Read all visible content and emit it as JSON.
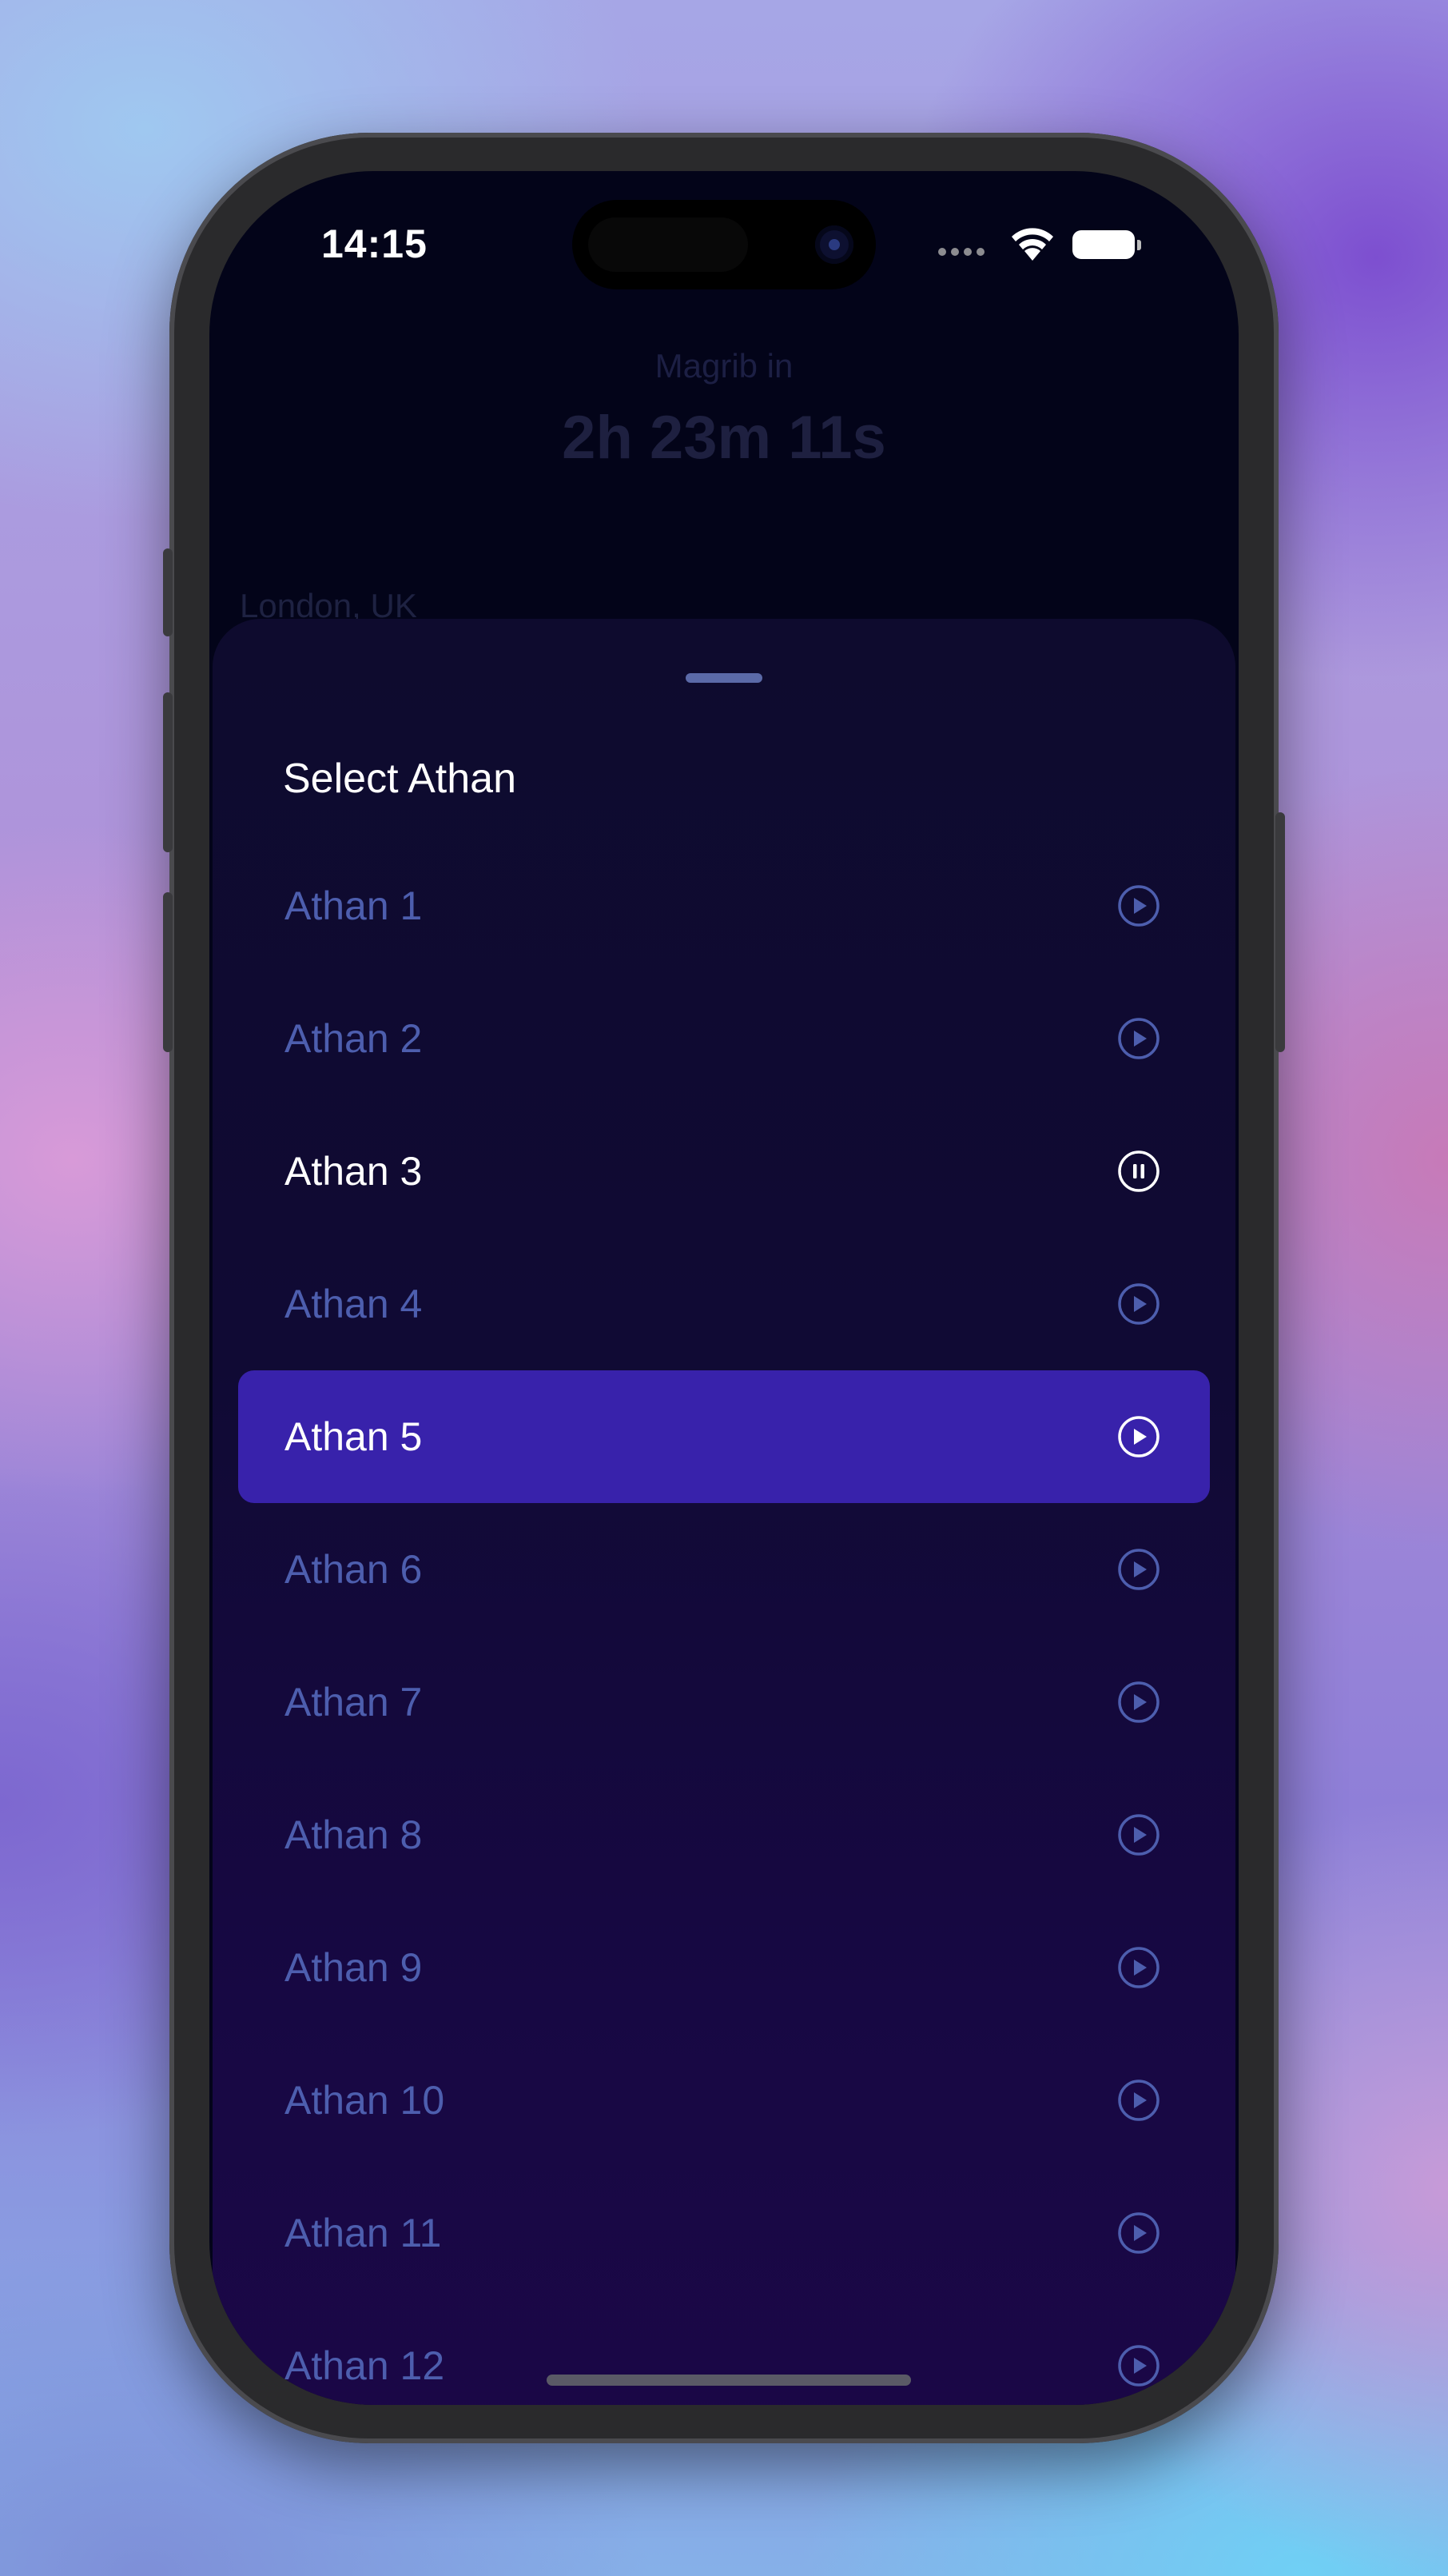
{
  "status_bar": {
    "time": "14:15"
  },
  "background_screen": {
    "next_prayer_label": "Magrib in",
    "countdown": "2h 23m 11s",
    "location": "London, UK"
  },
  "sheet": {
    "title": "Select Athan",
    "items": [
      {
        "label": "Athan 1",
        "icon": "play-icon"
      },
      {
        "label": "Athan 2",
        "icon": "play-icon"
      },
      {
        "label": "Athan 3",
        "icon": "pause-icon",
        "state": "playing"
      },
      {
        "label": "Athan 4",
        "icon": "play-icon"
      },
      {
        "label": "Athan 5",
        "icon": "play-icon",
        "state": "selected"
      },
      {
        "label": "Athan 6",
        "icon": "play-icon"
      },
      {
        "label": "Athan 7",
        "icon": "play-icon"
      },
      {
        "label": "Athan 8",
        "icon": "play-icon"
      },
      {
        "label": "Athan 9",
        "icon": "play-icon"
      },
      {
        "label": "Athan 10",
        "icon": "play-icon"
      },
      {
        "label": "Athan 11",
        "icon": "play-icon"
      },
      {
        "label": "Athan 12",
        "icon": "play-icon"
      }
    ]
  },
  "colors": {
    "selected_row": "#3822ab",
    "inactive_text": "#4d5eae",
    "active_text": "#ffffff"
  }
}
